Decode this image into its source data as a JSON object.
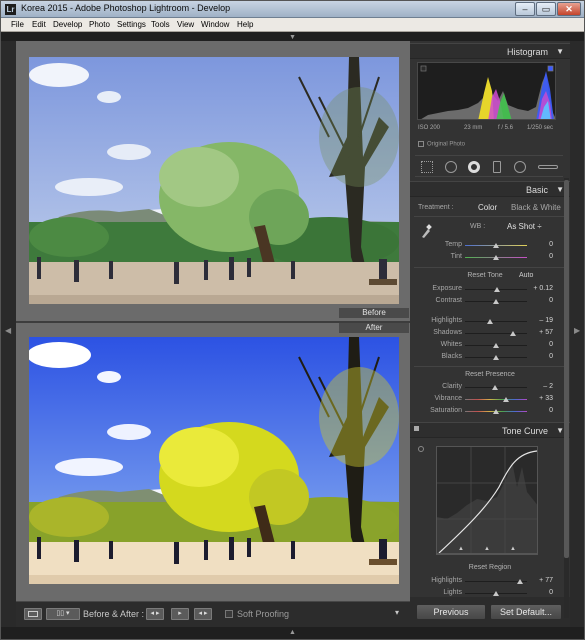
{
  "window": {
    "title": "Korea 2015 - Adobe Photoshop Lightroom - Develop",
    "app_icon": "Lr",
    "minimize": "–",
    "maximize": "▭",
    "close": "✕"
  },
  "menu": [
    "File",
    "Edit",
    "Develop",
    "Photo",
    "Settings",
    "Tools",
    "View",
    "Window",
    "Help"
  ],
  "arrows": {
    "top": "▲",
    "bottom": "▲",
    "left": "◀",
    "right": "▶"
  },
  "view": {
    "before_label": "Before",
    "after_label": "After"
  },
  "toolbar": {
    "before_after": "Before & After :",
    "soft_proofing": "Soft Proofing",
    "ba_btn1": "◂ ▸",
    "ba_btn2": "▸",
    "ba_btn3": "◂ ▸"
  },
  "histogram": {
    "title": "Histogram",
    "iso": "ISO 200",
    "focal": "23 mm",
    "aperture": "f / 5.6",
    "shutter": "1/250 sec",
    "original_photo": "Original Photo"
  },
  "basic": {
    "title": "Basic",
    "treatment_label": "Treatment :",
    "color": "Color",
    "bw": "Black & White",
    "wb_label": "WB :",
    "wb_value": "As Shot ÷",
    "tone_header": "Reset Tone",
    "auto": "Auto",
    "presence_header": "Reset Presence",
    "sliders": [
      {
        "label": "Temp",
        "value": "0",
        "pos": 0.5
      },
      {
        "label": "Tint",
        "value": "0",
        "pos": 0.5
      },
      {
        "label": "Exposure",
        "value": "+ 0.12",
        "pos": 0.52
      },
      {
        "label": "Contrast",
        "value": "0",
        "pos": 0.5
      },
      {
        "label": "Highlights",
        "value": "– 19",
        "pos": 0.41
      },
      {
        "label": "Shadows",
        "value": "+ 57",
        "pos": 0.78
      },
      {
        "label": "Whites",
        "value": "0",
        "pos": 0.5
      },
      {
        "label": "Blacks",
        "value": "0",
        "pos": 0.5
      },
      {
        "label": "Clarity",
        "value": "– 2",
        "pos": 0.49
      },
      {
        "label": "Vibrance",
        "value": "+ 33",
        "pos": 0.66
      },
      {
        "label": "Saturation",
        "value": "0",
        "pos": 0.5
      }
    ]
  },
  "tone_curve": {
    "title": "Tone Curve",
    "region_header": "Reset Region",
    "sliders": [
      {
        "label": "Highlights",
        "value": "+ 77",
        "pos": 0.88
      },
      {
        "label": "Lights",
        "value": "0",
        "pos": 0.5
      }
    ]
  },
  "buttons": {
    "previous": "Previous",
    "set_default": "Set Default..."
  }
}
